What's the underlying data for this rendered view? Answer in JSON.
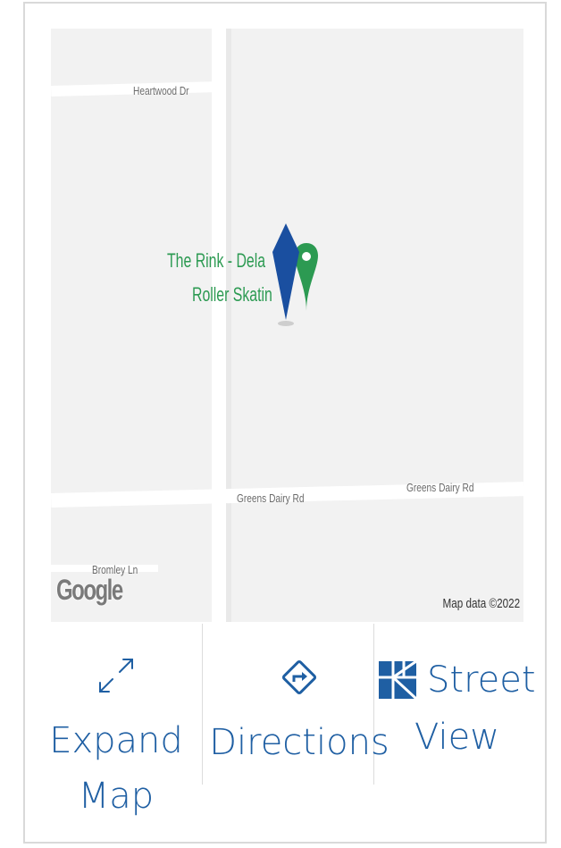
{
  "map": {
    "roads": {
      "top_road": "Heartwood Dr",
      "lower_road_left": "Greens Dairy Rd",
      "lower_road_right": "Greens Dairy Rd",
      "bottom_left_road": "Bromley Ln"
    },
    "poi": {
      "line1": "The Rink - Dela",
      "line2": "Roller Skatin"
    },
    "logo": "Google",
    "attribution": "Map data ©2022",
    "colors": {
      "poi_green": "#2c9a52",
      "marker_blue": "#1a4fa0",
      "road": "#ffffff",
      "land": "#f2f2f2"
    }
  },
  "actions": {
    "expand": {
      "icon": "expand-icon",
      "label_line1": "Expand",
      "label_line2": "Map"
    },
    "directions": {
      "icon": "directions-icon",
      "label": "Directions"
    },
    "street_view": {
      "icon": "street-view-icon",
      "label_line1": "Street",
      "label_line2": "View"
    },
    "accent_color": "#1f5fa3"
  }
}
